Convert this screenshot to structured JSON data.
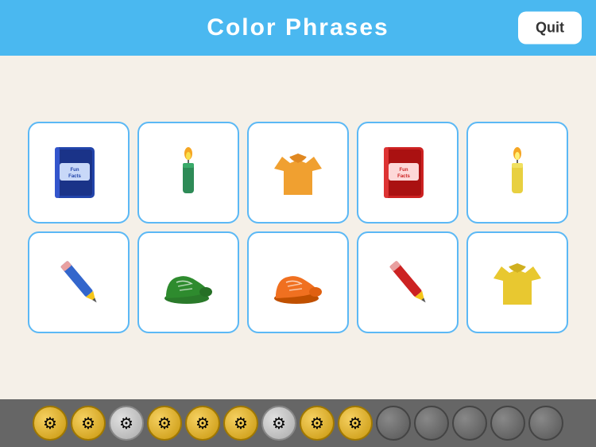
{
  "header": {
    "title": "Color  Phrases",
    "quit_label": "Quit"
  },
  "cards": {
    "row1": [
      {
        "id": "blue-book",
        "type": "book",
        "color": "blue"
      },
      {
        "id": "green-candle",
        "type": "candle",
        "color": "green"
      },
      {
        "id": "orange-shirt",
        "type": "shirt",
        "color": "orange"
      },
      {
        "id": "red-book",
        "type": "book",
        "color": "red"
      },
      {
        "id": "yellow-candle",
        "type": "candle",
        "color": "yellow"
      }
    ],
    "row2": [
      {
        "id": "blue-pencil",
        "type": "pencil",
        "color": "blue"
      },
      {
        "id": "green-shoe",
        "type": "shoe",
        "color": "green"
      },
      {
        "id": "orange-shoe",
        "type": "shoe",
        "color": "orange"
      },
      {
        "id": "red-pencil",
        "type": "pencil",
        "color": "red"
      },
      {
        "id": "yellow-shirt",
        "type": "shirt",
        "color": "yellow"
      }
    ]
  },
  "bottom": {
    "coins": [
      "gold-gear",
      "gold-gear",
      "silver-gear",
      "gold-gear",
      "gold-gear",
      "gold-gear",
      "silver-gear",
      "gold-gear",
      "gold-gear",
      "dark",
      "dark",
      "dark",
      "dark",
      "dark"
    ]
  }
}
